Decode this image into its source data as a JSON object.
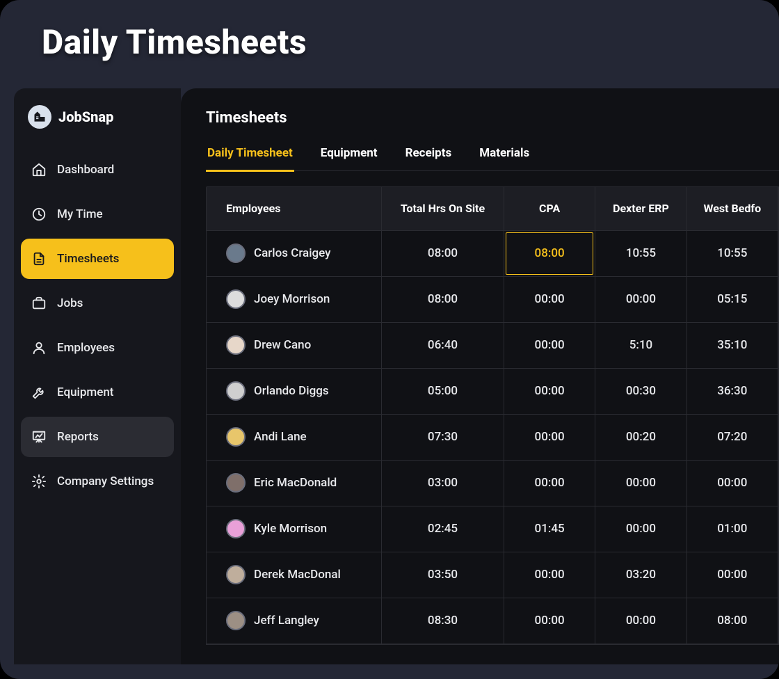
{
  "page_title": "Daily Timesheets",
  "brand": {
    "name": "JobSnap"
  },
  "sidebar": {
    "items": [
      {
        "id": "dashboard",
        "label": "Dashboard",
        "icon": "home-icon",
        "state": ""
      },
      {
        "id": "mytime",
        "label": "My Time",
        "icon": "clock-icon",
        "state": ""
      },
      {
        "id": "timesheets",
        "label": "Timesheets",
        "icon": "file-icon",
        "state": "active"
      },
      {
        "id": "jobs",
        "label": "Jobs",
        "icon": "briefcase-icon",
        "state": ""
      },
      {
        "id": "employees",
        "label": "Employees",
        "icon": "user-icon",
        "state": ""
      },
      {
        "id": "equipment",
        "label": "Equipment",
        "icon": "wrench-icon",
        "state": ""
      },
      {
        "id": "reports",
        "label": "Reports",
        "icon": "presentation-icon",
        "state": "hover"
      },
      {
        "id": "settings",
        "label": "Company Settings",
        "icon": "gear-icon",
        "state": ""
      }
    ]
  },
  "main": {
    "title": "Timesheets",
    "tabs": [
      {
        "id": "daily",
        "label": "Daily Timesheet",
        "active": true
      },
      {
        "id": "equipment",
        "label": "Equipment",
        "active": false
      },
      {
        "id": "receipts",
        "label": "Receipts",
        "active": false
      },
      {
        "id": "materials",
        "label": "Materials",
        "active": false
      }
    ],
    "columns": [
      {
        "id": "emp",
        "label": "Employees"
      },
      {
        "id": "total",
        "label": "Total Hrs On Site"
      },
      {
        "id": "cpa",
        "label": "CPA"
      },
      {
        "id": "dexter",
        "label": "Dexter ERP"
      },
      {
        "id": "west",
        "label": "West Bedfo"
      }
    ],
    "highlight": {
      "row": 0,
      "col": 2
    },
    "rows": [
      {
        "name": "Carlos Craigey",
        "avatar_bg": "#6a7a8c",
        "values": [
          "08:00",
          "08:00",
          "10:55",
          "10:55"
        ]
      },
      {
        "name": "Joey Morrison",
        "avatar_bg": "#dddddd",
        "values": [
          "08:00",
          "00:00",
          "00:00",
          "05:15"
        ]
      },
      {
        "name": "Drew Cano",
        "avatar_bg": "#e7d7c9",
        "values": [
          "06:40",
          "00:00",
          "5:10",
          "35:10"
        ]
      },
      {
        "name": "Orlando Diggs",
        "avatar_bg": "#cfcfcf",
        "values": [
          "05:00",
          "00:00",
          "00:30",
          "36:30"
        ]
      },
      {
        "name": "Andi Lane",
        "avatar_bg": "#e8c66b",
        "values": [
          "07:30",
          "00:00",
          "00:20",
          "07:20"
        ]
      },
      {
        "name": "Eric MacDonald",
        "avatar_bg": "#7f6f6a",
        "values": [
          "03:00",
          "00:00",
          "00:00",
          "00:00"
        ]
      },
      {
        "name": "Kyle Morrison",
        "avatar_bg": "#e9a0d8",
        "values": [
          "02:45",
          "01:45",
          "00:00",
          "01:00"
        ]
      },
      {
        "name": "Derek MacDonal",
        "avatar_bg": "#bfae9c",
        "values": [
          "03:50",
          "00:00",
          "03:20",
          "00:00"
        ]
      },
      {
        "name": "Jeff Langley",
        "avatar_bg": "#9c8f84",
        "values": [
          "08:30",
          "00:00",
          "00:00",
          "08:00"
        ]
      }
    ]
  }
}
